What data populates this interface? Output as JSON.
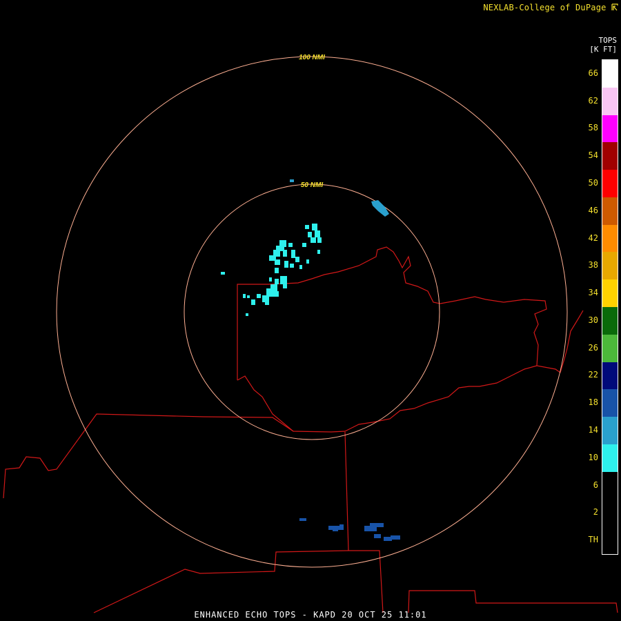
{
  "header": {
    "credit": "NEXLAB-College of DuPage",
    "credit_icon": "nexlab-logo-icon"
  },
  "footer": {
    "title": "ENHANCED ECHO TOPS - KAPD 20 OCT 25 11:01"
  },
  "rings": {
    "inner_label": "50 NMI",
    "outer_label": "100 NMI",
    "color": "#ffb093"
  },
  "legend": {
    "title": "TOPS",
    "units": "[K FT]",
    "label_color": "#f5e12e",
    "levels": [
      {
        "label": "66",
        "color": "#ffffff"
      },
      {
        "label": "62",
        "color": "#f8c6f3"
      },
      {
        "label": "58",
        "color": "#ff00ff"
      },
      {
        "label": "54",
        "color": "#a00000"
      },
      {
        "label": "50",
        "color": "#ff0000"
      },
      {
        "label": "46",
        "color": "#ce5a00"
      },
      {
        "label": "42",
        "color": "#ff8c00"
      },
      {
        "label": "38",
        "color": "#e8a800"
      },
      {
        "label": "34",
        "color": "#ffd200"
      },
      {
        "label": "30",
        "color": "#0a6a0a"
      },
      {
        "label": "26",
        "color": "#4cb83a"
      },
      {
        "label": "22",
        "color": "#000a7a"
      },
      {
        "label": "18",
        "color": "#1853a8"
      },
      {
        "label": "14",
        "color": "#2aa0cd"
      },
      {
        "label": "10",
        "color": "#2ef0ec"
      },
      {
        "label": "6",
        "color": "#000000"
      },
      {
        "label": "2",
        "color": "#000000"
      },
      {
        "label": "TH",
        "color": "#000000"
      }
    ]
  },
  "map": {
    "border_color": "#d21818",
    "echo_colors": {
      "low": "#2ef0ec",
      "mid": "#2aa0cd",
      "high": "#1853a8"
    }
  }
}
